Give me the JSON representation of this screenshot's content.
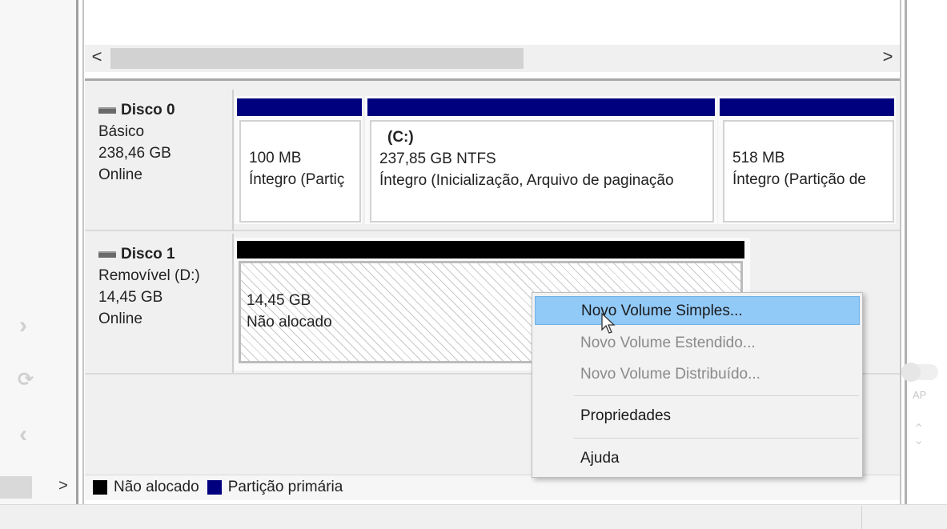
{
  "top_scrollbar": {
    "left_arrow": "<",
    "right_arrow": ">"
  },
  "disks": [
    {
      "name": "Disco 0",
      "type": "Básico",
      "size": "238,46 GB",
      "status": "Online",
      "partitions": [
        {
          "title": "",
          "size": "100 MB",
          "status": "Íntegro (Partiç"
        },
        {
          "title": "(C:)",
          "size": "237,85 GB NTFS",
          "status": "Íntegro (Inicialização, Arquivo de paginação"
        },
        {
          "title": "",
          "size": "518 MB",
          "status": "Íntegro (Partição de"
        }
      ]
    },
    {
      "name": "Disco 1",
      "type": "Removível (D:)",
      "size": "14,45 GB",
      "status": "Online",
      "partitions": [
        {
          "title": "",
          "size": "14,45 GB",
          "status": "Não alocado"
        }
      ]
    }
  ],
  "legend": [
    {
      "label": "Não alocado",
      "color": "#000000"
    },
    {
      "label": "Partição primária",
      "color": "#00007f"
    }
  ],
  "context_menu": {
    "items": [
      {
        "label": "Novo Volume Simples...",
        "enabled": true,
        "highlighted": true
      },
      {
        "label": "Novo Volume Estendido...",
        "enabled": false
      },
      {
        "label": "Novo Volume Distribuído...",
        "enabled": false
      },
      {
        "label": "Propriedades",
        "enabled": true
      },
      {
        "label": "Ajuda",
        "enabled": true
      }
    ]
  },
  "side": {
    "ap_label": "AP",
    "left_scroll_arrow": ">"
  },
  "colors": {
    "primary_partition": "#00007f",
    "unallocated": "#000000",
    "menu_highlight": "#91c9f7"
  }
}
